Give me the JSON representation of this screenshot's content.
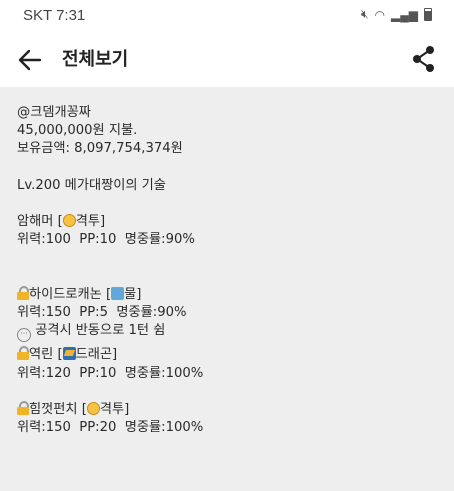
{
  "status_bar": {
    "carrier": "SKT",
    "time": "7:31"
  },
  "toolbar": {
    "title": "전체보기",
    "back_icon": "arrow-left-icon",
    "share_icon": "share-icon"
  },
  "post": {
    "author": "@크뎀개꽁짜",
    "payment": "45,000,000원 지불.",
    "balance": "보유금액: 8,097,754,374원",
    "skill_title": "Lv.200 메가대짱이의 기술",
    "moves": [
      {
        "name_prefix": "암해머 [",
        "type": "격투]",
        "stats": "위력:100  PP:10  명중률:90%",
        "note": ""
      },
      {
        "name_prefix": "하이드로캐논 [",
        "type": "물]",
        "stats": "위력:150  PP:5  명중률:90%",
        "note": "공격시 반동으로 1턴 쉼"
      },
      {
        "name_prefix": "역린 [",
        "type": "드래곤]",
        "stats": "위력:120  PP:10  명중률:100%",
        "note": ""
      },
      {
        "name_prefix": "힘껏펀치 [",
        "type": "격투]",
        "stats": "위력:150  PP:20  명중률:100%",
        "note": ""
      }
    ]
  }
}
